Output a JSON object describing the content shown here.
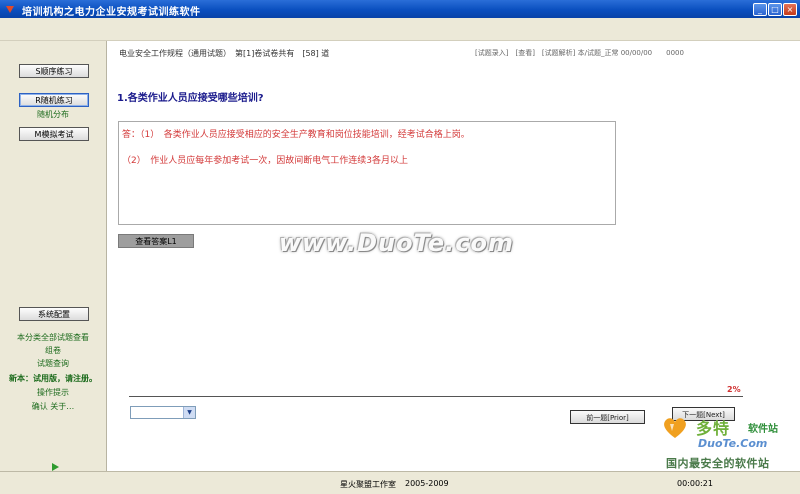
{
  "window": {
    "title": "培训机构之电力企业安规考试训练软件"
  },
  "sidebar": {
    "buttons": [
      "S顺序练习",
      "R随机练习",
      "M模拟考试"
    ],
    "random_sub": "随机分布",
    "config_button": "系统配置",
    "links": [
      "本分类全部试题查看",
      "组卷",
      "试题查询",
      "新本：试用版，请注册。",
      "操作提示",
      "确认  关于…"
    ]
  },
  "question": {
    "header": "电业安全工作规程（通用试题）　第[1]卷试卷共有　[58] 道",
    "header_right": "[试题录入]　[查看]　[试题解析] 本/试题_正常 00/00/00　　0000",
    "title": "1.各类作业人员应接受哪些培训?",
    "answer_lines": [
      "答：（1）　各类作业人员应接受相应的安全生产教育和岗位技能培训，经考试合格上岗。",
      "（2）　作业人员应每年参加考试一次，因故间断电气工作连续3各月以上"
    ],
    "view_answer_button": "查看答案L1",
    "watermark": "www.DuoTe.com"
  },
  "progress": {
    "label": "2%",
    "value_percent": 2
  },
  "nav": {
    "select_value": "",
    "prev_button": "前一题[Prior]",
    "next_button": "下一题[Next]"
  },
  "statusbar": {
    "studio": "星火聚盟工作室",
    "years": "2005-2009",
    "timer": "00:00:21"
  },
  "logo": {
    "line1": "多特",
    "line1b": "软件站",
    "line2": "DuoTe.Com",
    "line3": "国内最安全的软件站"
  }
}
